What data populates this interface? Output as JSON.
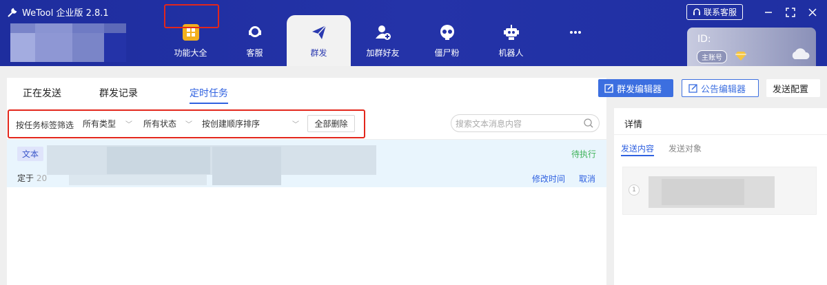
{
  "app": {
    "title": "WeTool 企业版 2.8.1",
    "support_label": "联系客服"
  },
  "nav": [
    {
      "label": "功能大全",
      "icon": "grid-icon"
    },
    {
      "label": "客服",
      "icon": "headset-icon"
    },
    {
      "label": "群发",
      "icon": "paper-plane-icon",
      "active": true
    },
    {
      "label": "加群好友",
      "icon": "add-user-icon"
    },
    {
      "label": "僵尸粉",
      "icon": "skull-icon"
    },
    {
      "label": "机器人",
      "icon": "robot-icon"
    },
    {
      "label": "",
      "icon": "more-icon"
    }
  ],
  "account": {
    "id_label": "ID:",
    "badge": "主账号"
  },
  "tabs": [
    {
      "label": "正在发送"
    },
    {
      "label": "群发记录"
    },
    {
      "label": "定时任务",
      "active": true
    }
  ],
  "toolbar": {
    "editor": "群发编辑器",
    "notice_editor": "公告编辑器",
    "config": "发送配置"
  },
  "filters": {
    "label": "按任务标签筛选",
    "type": "所有类型",
    "status": "所有状态",
    "sort": "按创建顺序排序",
    "delete_all": "全部删除",
    "search_placeholder": "搜索文本消息内容"
  },
  "task": {
    "tag": "文本",
    "status": "待执行",
    "schedule_prefix": "定于",
    "schedule_partial": "20",
    "edit_time": "修改时间",
    "cancel": "取消"
  },
  "detail": {
    "title": "详情",
    "tabs": [
      {
        "label": "发送内容",
        "active": true
      },
      {
        "label": "发送对象"
      }
    ],
    "item_number": "1"
  },
  "colors": {
    "topbar": "#2433a8",
    "accent": "#2f61e0",
    "highlight": "#e3261b",
    "pending": "#3fb35a"
  }
}
